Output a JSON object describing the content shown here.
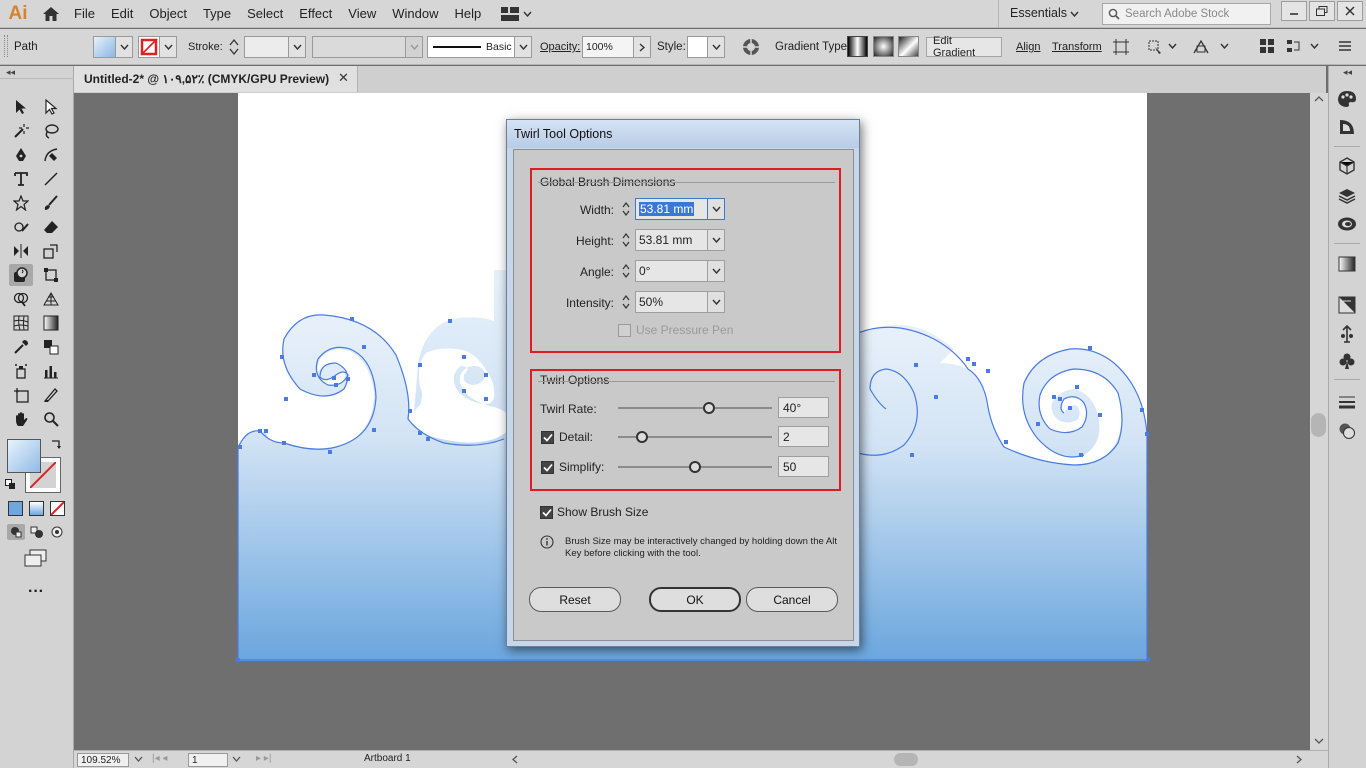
{
  "app": {
    "logo": "Ai",
    "workspace": "Essentials",
    "search_placeholder": "Search Adobe Stock"
  },
  "menu": [
    "File",
    "Edit",
    "Object",
    "Type",
    "Select",
    "Effect",
    "View",
    "Window",
    "Help"
  ],
  "control_bar": {
    "selection": "Path",
    "stroke_label": "Stroke:",
    "brush_label": "Basic",
    "opacity_label": "Opacity:",
    "opacity_value": "100%",
    "style_label": "Style:",
    "gradient_type_label": "Gradient Type:",
    "edit_gradient": "Edit Gradient",
    "align": "Align",
    "transform": "Transform"
  },
  "document_tab": {
    "title": "Untitled-2* @ ۱۰۹,۵۲٪ (CMYK/GPU Preview)",
    "close": "✕"
  },
  "status_bar": {
    "zoom": "109.52%",
    "artboard_number": "1",
    "artboard_name": "Artboard 1"
  },
  "dialog": {
    "title": "Twirl Tool Options",
    "global_group": {
      "title": "Global Brush Dimensions",
      "fields": [
        {
          "label": "Width:",
          "value": "53.81 mm"
        },
        {
          "label": "Height:",
          "value": "53.81 mm"
        },
        {
          "label": "Angle:",
          "value": "0°"
        },
        {
          "label": "Intensity:",
          "value": "50%"
        }
      ],
      "pressure_label": "Use Pressure Pen"
    },
    "twirl_group": {
      "title": "Twirl Options",
      "rate": {
        "label": "Twirl Rate:",
        "value": "40°",
        "fraction": 0.6
      },
      "detail": {
        "label": "Detail:",
        "value": "2",
        "checked": true,
        "fraction": 0.13
      },
      "simplify": {
        "label": "Simplify:",
        "value": "50",
        "checked": true,
        "fraction": 0.5
      }
    },
    "show_brush_size": {
      "label": "Show Brush Size",
      "checked": true
    },
    "info_text": "Brush Size may be interactively changed by holding down the Alt Key before clicking with the tool.",
    "buttons": {
      "reset": "Reset",
      "ok": "OK",
      "cancel": "Cancel"
    }
  },
  "colors": {
    "accent": "#e01b24",
    "selection": "#4a7be2",
    "wave_top": "#dce9f6",
    "wave_bottom": "#6ea6de"
  }
}
